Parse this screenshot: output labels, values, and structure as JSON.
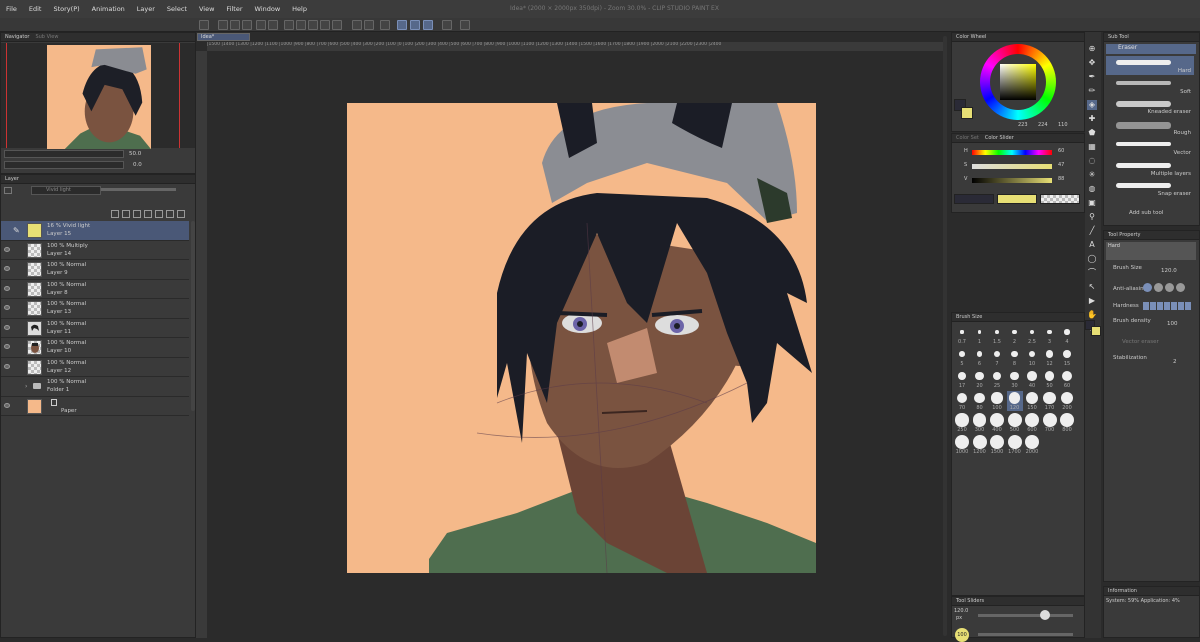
{
  "window_title": "Idea* (2000 × 2000px 350dpi) - Zoom 30.0% - CLIP STUDIO PAINT EX",
  "menu": [
    "File",
    "Edit",
    "Story(P)",
    "Animation",
    "Layer",
    "Select",
    "View",
    "Filter",
    "Window",
    "Help"
  ],
  "navigator": {
    "tabs": [
      "Navigator",
      "Sub View"
    ],
    "zoom": "50.0",
    "angle": "0.0"
  },
  "layer_panel": {
    "tab": "Layer",
    "blend_mode": "Vivid light",
    "layers": [
      {
        "blend": "16 % Vivid light",
        "name": "Layer 15",
        "selected": true,
        "thumb": "yellow"
      },
      {
        "blend": "100 % Multiply",
        "name": "Layer 14",
        "thumb": "checker"
      },
      {
        "blend": "100 % Normal",
        "name": "Layer 9",
        "thumb": "checker"
      },
      {
        "blend": "100 % Normal",
        "name": "Layer 8",
        "thumb": "checker"
      },
      {
        "blend": "100 % Normal",
        "name": "Layer 13",
        "thumb": "checker"
      },
      {
        "blend": "100 % Normal",
        "name": "Layer 11",
        "thumb": "sketch"
      },
      {
        "blend": "100 % Normal",
        "name": "Layer 10",
        "thumb": "figure"
      },
      {
        "blend": "100 % Normal",
        "name": "Layer 12",
        "thumb": "checker"
      },
      {
        "blend": "100 % Normal",
        "name": "Folder 1",
        "thumb": "folder"
      },
      {
        "blend": "",
        "name": "Paper",
        "thumb": "paper"
      }
    ]
  },
  "canvas": {
    "doc_tab": "Idea*",
    "ruler_ticks": [
      "1500",
      "1400",
      "1300",
      "1200",
      "1100",
      "1000",
      "900",
      "800",
      "700",
      "600",
      "500",
      "400",
      "300",
      "200",
      "100",
      "0",
      "100",
      "200",
      "300",
      "400",
      "500",
      "600",
      "700",
      "800",
      "900",
      "1000",
      "1100",
      "1200",
      "1300",
      "1400",
      "1500",
      "1600",
      "1700",
      "1800",
      "1900",
      "2000",
      "2100",
      "2200",
      "2300",
      "2400"
    ],
    "bg_color": "#f5b98a"
  },
  "color_wheel": {
    "tab": "Color Wheel",
    "h": "223",
    "s": "224",
    "v": "110",
    "main_color": "#2a2a36",
    "sub_color": "#e7df75"
  },
  "color_slider": {
    "tabs": [
      "Color Set",
      "Color Slider"
    ],
    "H": "60",
    "S": "47",
    "V": "88"
  },
  "brush_size": {
    "tab": "Brush Size",
    "sizes": [
      "0.7",
      "1",
      "1.5",
      "2",
      "2.5",
      "3",
      "4",
      "5",
      "6",
      "7",
      "8",
      "10",
      "12",
      "15",
      "17",
      "20",
      "25",
      "30",
      "40",
      "50",
      "60",
      "70",
      "80",
      "100",
      "120",
      "150",
      "170",
      "200",
      "250",
      "300",
      "400",
      "500",
      "600",
      "700",
      "800",
      "1000",
      "1200",
      "1500",
      "1700",
      "2000"
    ],
    "selected": "120"
  },
  "tool_sliders": {
    "tab": "Tool Sliders",
    "size": "120.0",
    "unit": "px",
    "opacity": "100"
  },
  "sub_tool": {
    "tab": "Sub Tool",
    "group": "Eraser",
    "items": [
      {
        "name": "Hard",
        "selected": true
      },
      {
        "name": "Soft"
      },
      {
        "name": "Kneaded eraser"
      },
      {
        "name": "Rough"
      },
      {
        "name": "Vector"
      },
      {
        "name": "Multiple layers"
      },
      {
        "name": "Snap eraser"
      }
    ],
    "add_label": "Add sub tool"
  },
  "tool_property": {
    "tab": "Tool Property",
    "preset": "Hard",
    "brush_size_label": "Brush Size",
    "brush_size": "120.0",
    "anti_alias_label": "Anti-aliasing",
    "hardness_label": "Hardness",
    "brush_density_label": "Brush density",
    "brush_density": "100",
    "vector_eraser_label": "Vector eraser",
    "stabilization_label": "Stabilization",
    "stabilization": "2"
  },
  "information": {
    "tab": "Information",
    "system": "System: 59% Application: 4%"
  }
}
